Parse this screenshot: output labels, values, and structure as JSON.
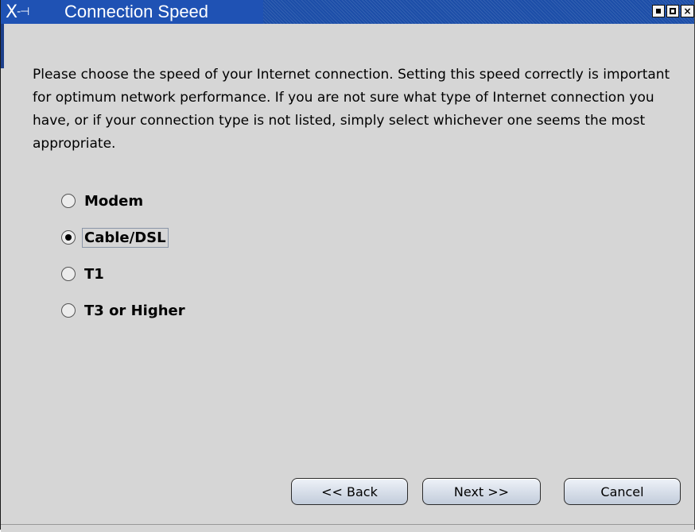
{
  "window": {
    "title": "Connection Speed",
    "logo_text": "X-⌐",
    "controls": [
      "minimize-icon",
      "maximize-icon",
      "close-icon"
    ]
  },
  "description": "Please choose the speed of your Internet connection. Setting this speed correctly is important for optimum network performance. If you are not sure what type of Internet connection you have, or if your connection type is not listed, simply select whichever one seems the most appropriate.",
  "options": [
    {
      "label": "Modem",
      "selected": false
    },
    {
      "label": "Cable/DSL",
      "selected": true
    },
    {
      "label": "T1",
      "selected": false
    },
    {
      "label": "T3 or Higher",
      "selected": false
    }
  ],
  "buttons": {
    "back": "<< Back",
    "next": "Next >>",
    "cancel": "Cancel"
  },
  "colors": {
    "titlebar": "#1c4ea8",
    "background": "#d6d6d6",
    "button_gradient_top": "#eef2f8",
    "button_gradient_bottom": "#c2ccdb"
  }
}
